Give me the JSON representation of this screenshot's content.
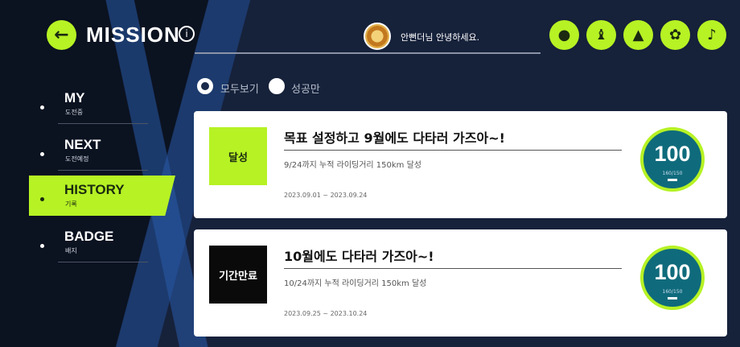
{
  "header": {
    "back_label": "←",
    "title": "MISSION",
    "info_label": "i",
    "greeting": "안뻔더님 안녕하세요.",
    "buttons": [
      {
        "icon": "person-icon",
        "glyph": "●"
      },
      {
        "icon": "trophy-icon",
        "glyph": "♝"
      },
      {
        "icon": "bell-icon",
        "glyph": "▲"
      },
      {
        "icon": "gear-icon",
        "glyph": "✿"
      },
      {
        "icon": "music-icon",
        "glyph": "♪"
      }
    ]
  },
  "sidebar": {
    "items": [
      {
        "label": "MY",
        "sub": "도전중"
      },
      {
        "label": "NEXT",
        "sub": "도전예정"
      },
      {
        "label": "HISTORY",
        "sub": "기록"
      },
      {
        "label": "BADGE",
        "sub": "배지"
      }
    ]
  },
  "filters": {
    "all_label": "모두보기",
    "success_label": "성공만"
  },
  "cards": [
    {
      "status": "달성",
      "title": "목표 설정하고 9월에도 다타러 가즈아~!",
      "desc": "9/24까지 누적 라이딩거리 150km 달성",
      "date": "2023.09.01 ~ 2023.09.24",
      "percent": "100",
      "progress": "160/150"
    },
    {
      "status": "기간만료",
      "title": "10월에도 다타러 가즈아~!",
      "desc": "10/24까지 누적 라이딩거리 150km 달성",
      "date": "2023.09.25 ~ 2023.10.24",
      "percent": "100",
      "progress": "160/150"
    }
  ],
  "colors": {
    "accent": "#b6f224",
    "background": "#0b1220",
    "gauge": "#0f6b7c"
  }
}
